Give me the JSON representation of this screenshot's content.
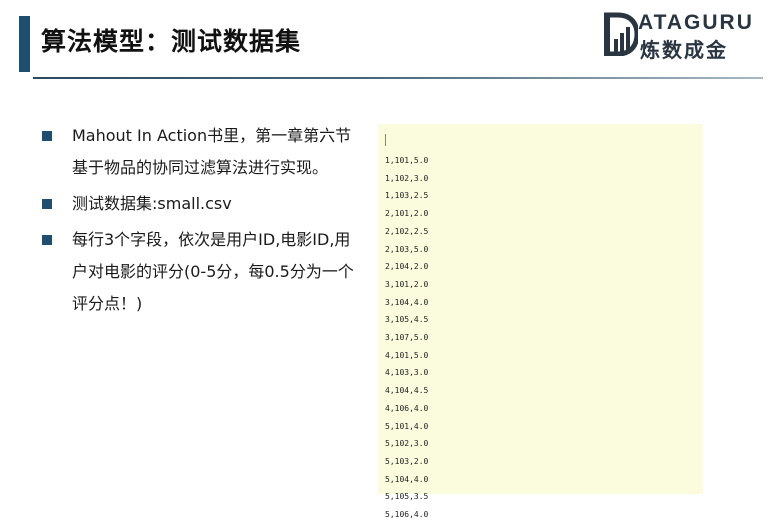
{
  "header": {
    "title": "算法模型：测试数据集",
    "logo_top": "ATAGURU",
    "logo_bottom": "炼数成金"
  },
  "bullets": [
    "Mahout In Action书里，第一章第六节基于物品的协同过滤算法进行实现。",
    "测试数据集:small.csv",
    "每行3个字段，依次是用户ID,电影ID,用户对电影的评分(0-5分，每0.5分为一个评分点！)"
  ],
  "dataset": {
    "rows": [
      "1,101,5.0",
      "1,102,3.0",
      "1,103,2.5",
      "2,101,2.0",
      "2,102,2.5",
      "2,103,5.0",
      "2,104,2.0",
      "3,101,2.0",
      "3,104,4.0",
      "3,105,4.5",
      "3,107,5.0",
      "4,101,5.0",
      "4,103,3.0",
      "4,104,4.5",
      "4,106,4.0",
      "5,101,4.0",
      "5,102,3.0",
      "5,103,2.0",
      "5,104,4.0",
      "5,105,3.5",
      "5,106,4.0"
    ]
  },
  "colors": {
    "accent": "#1f4e6e",
    "panel_background": "#fbfbdd",
    "logo": "#2a3542"
  },
  "icons": {
    "logo_mark": "bar-chart-logo-icon",
    "bullet_marker": "square-bullet-icon"
  }
}
